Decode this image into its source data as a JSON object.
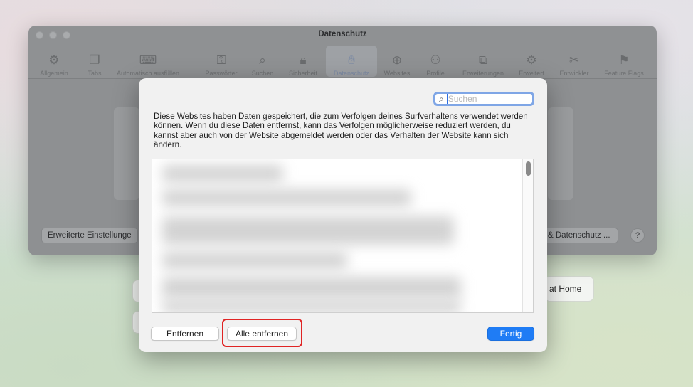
{
  "window": {
    "title": "Datenschutz",
    "toolbar": [
      {
        "label": "Allgemein",
        "icon": "gear-icon"
      },
      {
        "label": "Tabs",
        "icon": "tabs-icon"
      },
      {
        "label": "Automatisch ausfüllen",
        "icon": "autofill-icon"
      },
      {
        "label": "Passwörter",
        "icon": "key-icon"
      },
      {
        "label": "Suchen",
        "icon": "search-icon"
      },
      {
        "label": "Sicherheit",
        "icon": "lock-icon"
      },
      {
        "label": "Datenschutz",
        "icon": "hand-icon"
      },
      {
        "label": "Websites",
        "icon": "globe-icon"
      },
      {
        "label": "Profile",
        "icon": "person-icon"
      },
      {
        "label": "Erweiterungen",
        "icon": "puzzle-icon"
      },
      {
        "label": "Erweitert",
        "icon": "gears-icon"
      },
      {
        "label": "Entwickler",
        "icon": "tools-icon"
      },
      {
        "label": "Feature Flags",
        "icon": "flags-icon"
      }
    ],
    "selected_tab": "Datenschutz",
    "advanced_button": "Erweiterte Einstellunge",
    "privacy_button": "& Datenschutz ...",
    "help_button": "?"
  },
  "background": {
    "home_label": "at Home"
  },
  "dialog": {
    "search_placeholder": "Suchen",
    "description": "Diese Websites haben Daten gespeichert, die zum Verfolgen deines Surfverhaltens verwendet werden können. Wenn du diese Daten entfernst, kann das Verfolgen möglicherweise reduziert werden, du kannst aber auch von der Website abgemeldet werden oder das Verhalten der Website kann sich ändern.",
    "buttons": {
      "remove": "Entfernen",
      "remove_all": "Alle entfernen",
      "done": "Fertig"
    }
  },
  "colors": {
    "accent": "#1f7cf5",
    "highlight": "#e02424",
    "focus_ring": "#7fa6e6"
  }
}
